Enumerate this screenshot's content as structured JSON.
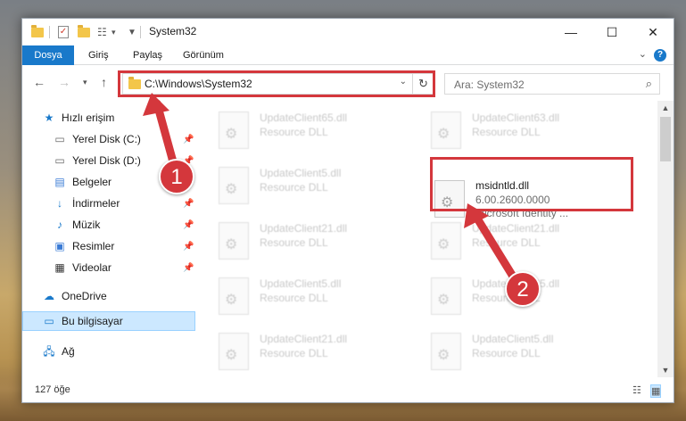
{
  "window": {
    "title": "System32",
    "controls": {
      "minimize": "—",
      "maximize": "☐",
      "close": "✕"
    }
  },
  "ribbon": {
    "tabs": [
      "Dosya",
      "Giriş",
      "Paylaş",
      "Görünüm"
    ],
    "help": "?"
  },
  "nav": {
    "address": "C:\\Windows\\System32",
    "search_placeholder": "Ara: System32"
  },
  "sidebar": {
    "items": [
      {
        "label": "Hızlı erişim",
        "icon": "star-icon",
        "pinned": false
      },
      {
        "label": "Yerel Disk (C:)",
        "icon": "drive-icon",
        "pinned": true
      },
      {
        "label": "Yerel Disk (D:)",
        "icon": "drive-icon",
        "pinned": true
      },
      {
        "label": "Belgeler",
        "icon": "documents-icon",
        "pinned": true
      },
      {
        "label": "İndirmeler",
        "icon": "download-icon",
        "pinned": true
      },
      {
        "label": "Müzik",
        "icon": "music-icon",
        "pinned": true
      },
      {
        "label": "Resimler",
        "icon": "pictures-icon",
        "pinned": true
      },
      {
        "label": "Videolar",
        "icon": "video-icon",
        "pinned": true
      },
      {
        "label": "OneDrive",
        "icon": "cloud-icon",
        "pinned": false
      },
      {
        "label": "Bu bilgisayar",
        "icon": "computer-icon",
        "pinned": false
      },
      {
        "label": "Ağ",
        "icon": "network-icon",
        "pinned": false
      }
    ]
  },
  "files": [
    {
      "name": "UpdateClient65.dll",
      "desc": "Resource DLL"
    },
    {
      "name": "UpdateClient63.dll",
      "desc": "Resource DLL"
    },
    {
      "name": "UpdateClient5.dll",
      "desc": "Resource DLL"
    },
    {
      "name": "msidntld.dll",
      "desc": "6.00.2600.0000",
      "extra": "Microsoft Identity ..."
    },
    {
      "name": "UpdateClient21.dll",
      "desc": "Resource DLL"
    },
    {
      "name": "UpdateClient21.dll",
      "desc": "Resource DLL"
    },
    {
      "name": "UpdateClient5.dll",
      "desc": "Resource DLL"
    },
    {
      "name": "UpdateClient65.dll",
      "desc": "Resource DLL"
    },
    {
      "name": "UpdateClient21.dll",
      "desc": "Resource DLL"
    },
    {
      "name": "UpdateClient5.dll",
      "desc": "Resource DLL"
    }
  ],
  "status": {
    "item_count": "127 öğe"
  },
  "annotations": {
    "badge1": "1",
    "badge2": "2",
    "color": "#d4373c"
  }
}
